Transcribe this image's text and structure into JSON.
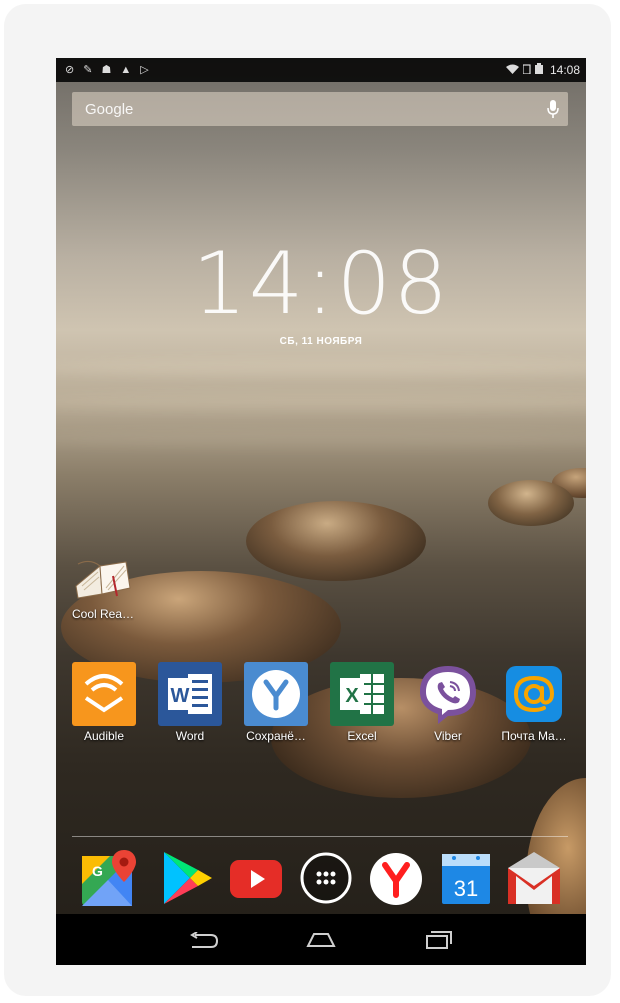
{
  "status_bar": {
    "left_icons": [
      "vpn-icon",
      "wrench-icon",
      "android-icon",
      "warning-icon",
      "play-icon"
    ],
    "right_icons": [
      "wifi-icon",
      "signal-icon",
      "battery-icon"
    ],
    "time": "14:08"
  },
  "search": {
    "label": "Google"
  },
  "clock": {
    "time": "14:08",
    "date": "СБ, 11 НОЯБРЯ"
  },
  "desktop_icon": {
    "label": "Cool Rea…"
  },
  "apps": [
    {
      "label": "Audible",
      "icon": "audible-icon",
      "color": "#f7961d"
    },
    {
      "label": "Word",
      "icon": "word-icon",
      "color": "#2b579a"
    },
    {
      "label": "Сохранё…",
      "icon": "yandex-collections-icon",
      "color": "#4a8bd0"
    },
    {
      "label": "Excel",
      "icon": "excel-icon",
      "color": "#217346"
    },
    {
      "label": "Viber",
      "icon": "viber-icon",
      "color": "#7b519d"
    },
    {
      "label": "Почта Ma…",
      "icon": "mail-ru-icon",
      "color": "#168de2"
    }
  ],
  "dock": [
    {
      "name": "google-maps-icon"
    },
    {
      "name": "google-play-icon"
    },
    {
      "name": "youtube-icon"
    },
    {
      "name": "app-drawer-icon"
    },
    {
      "name": "yandex-browser-icon"
    },
    {
      "name": "calendar-icon",
      "text": "31"
    },
    {
      "name": "gmail-icon"
    }
  ],
  "nav": [
    "back-icon",
    "home-icon",
    "recents-icon"
  ]
}
